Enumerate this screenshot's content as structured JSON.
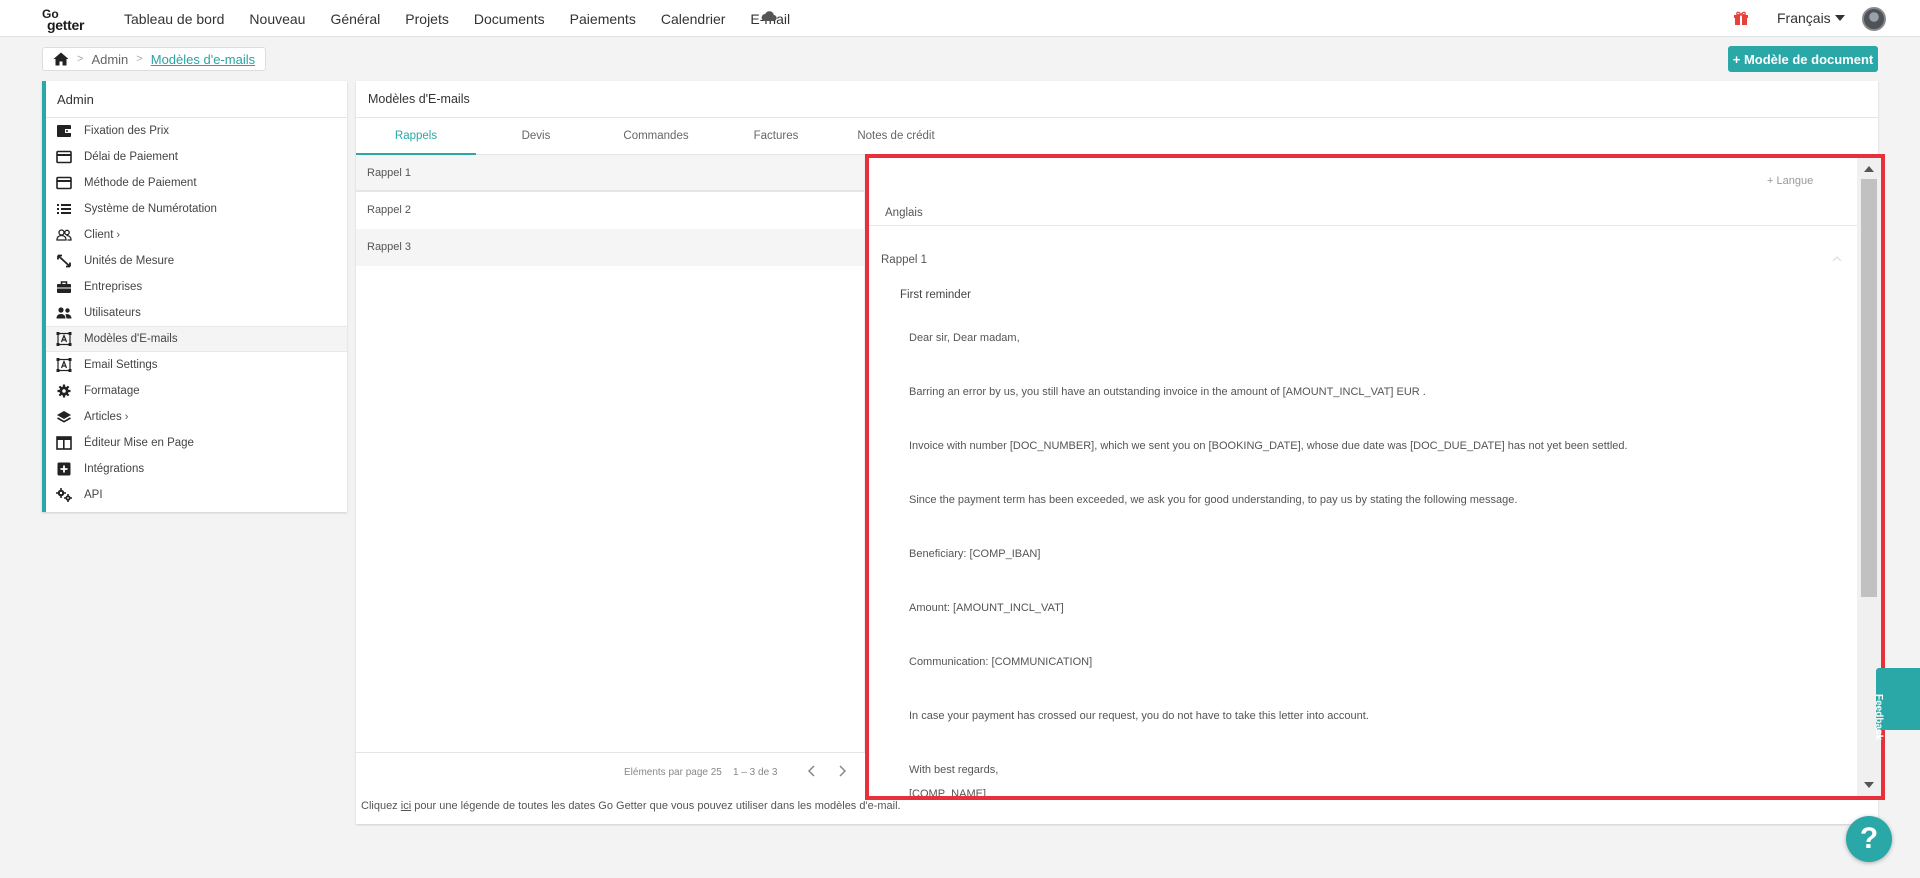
{
  "brand": {
    "logo_top": "Go",
    "logo_bottom": "getter"
  },
  "nav": {
    "items": [
      "Tableau de bord",
      "Nouveau",
      "Général",
      "Projets",
      "Documents",
      "Paiements",
      "Calendrier",
      "E-mail"
    ],
    "language": "Français"
  },
  "breadcrumb": {
    "admin": "Admin",
    "current": "Modèles d'e-mails"
  },
  "actions": {
    "new_doc_template": "+ Modèle de document"
  },
  "sidebar": {
    "title": "Admin",
    "items": [
      {
        "label": "Fixation des Prix",
        "icon": "wallet-icon"
      },
      {
        "label": "Délai de Paiement",
        "icon": "card-icon"
      },
      {
        "label": "Méthode de Paiement",
        "icon": "card-icon"
      },
      {
        "label": "Système de Numérotation",
        "icon": "list-icon"
      },
      {
        "label": "Client",
        "icon": "users-outline-icon"
      },
      {
        "label": "Unités de Mesure",
        "icon": "resize-icon"
      },
      {
        "label": "Entreprises",
        "icon": "briefcase-icon"
      },
      {
        "label": "Utilisateurs",
        "icon": "people-icon"
      },
      {
        "label": "Modèles d'E-mails",
        "icon": "template-icon"
      },
      {
        "label": "Email Settings",
        "icon": "template-icon"
      },
      {
        "label": "Formatage",
        "icon": "gear-icon"
      },
      {
        "label": "Articles",
        "icon": "layers-icon"
      },
      {
        "label": "Éditeur Mise en Page",
        "icon": "layout-icon"
      },
      {
        "label": "Intégrations",
        "icon": "plus-box-icon"
      },
      {
        "label": "API",
        "icon": "gears-icon"
      }
    ]
  },
  "main": {
    "title": "Modèles d'E-mails",
    "tabs": [
      "Rappels",
      "Devis",
      "Commandes",
      "Factures",
      "Notes de crédit"
    ],
    "list": [
      "Rappel 1",
      "Rappel 2",
      "Rappel 3"
    ],
    "pagination": {
      "per_page": "Eléments par page 25",
      "range": "1 – 3 de 3"
    },
    "legend": {
      "prefix": "Cliquez ",
      "link": "ici",
      "suffix": " pour une légende de toutes les dates Go Getter que vous pouvez utiliser dans les modèles d'e-mail."
    }
  },
  "editor": {
    "add_language": "+ Langue",
    "language": "Anglais",
    "section": "Rappel 1",
    "subject": "First reminder",
    "body": [
      "Dear sir, Dear madam,",
      "Barring an error by us, you still have an outstanding invoice in the amount of [AMOUNT_INCL_VAT] EUR .",
      "Invoice with number [DOC_NUMBER], which we sent you on [BOOKING_DATE], whose due date was [DOC_DUE_DATE] has not yet been settled.",
      "Since the payment term has been exceeded, we ask you for good understanding, to pay us by stating the following message.",
      "Beneficiary: [COMP_IBAN]",
      "Amount: [AMOUNT_INCL_VAT]",
      "Communication: [COMMUNICATION]",
      "In case your payment has crossed our request, you do not have to take this letter into account.",
      "With best regards,",
      "[COMP_NAME]"
    ]
  },
  "widgets": {
    "feedback": "Feedback",
    "help": "?"
  },
  "colors": {
    "accent": "#2aa7a7",
    "highlight": "#e6313a",
    "gift": "#e8403a"
  }
}
